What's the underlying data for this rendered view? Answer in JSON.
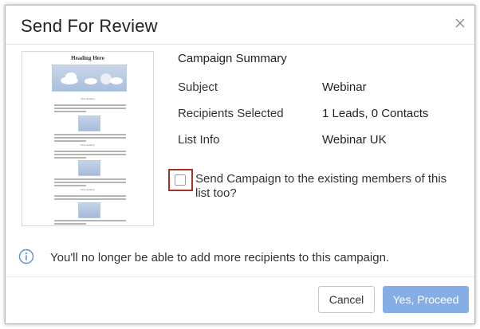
{
  "dialog": {
    "title": "Send For Review",
    "close_icon": "close-icon"
  },
  "preview": {
    "heading": "Heading Here",
    "sub_heading": "Sub Heading"
  },
  "summary": {
    "title": "Campaign Summary",
    "rows": [
      {
        "label": "Subject",
        "value": "Webinar"
      },
      {
        "label": "Recipients Selected",
        "value": "1 Leads, 0 Contacts"
      },
      {
        "label": "List Info",
        "value": "Webinar UK"
      }
    ]
  },
  "checkbox": {
    "label": "Send Campaign to the existing members of this list too?",
    "checked": false
  },
  "info": {
    "icon": "info-icon",
    "text": "You'll no longer be able to add more recipients to this campaign."
  },
  "buttons": {
    "cancel": "Cancel",
    "proceed": "Yes, Proceed"
  },
  "colors": {
    "primary_button": "#86aee6",
    "highlight_border": "#a2342a",
    "info_icon": "#5b8fd1"
  }
}
